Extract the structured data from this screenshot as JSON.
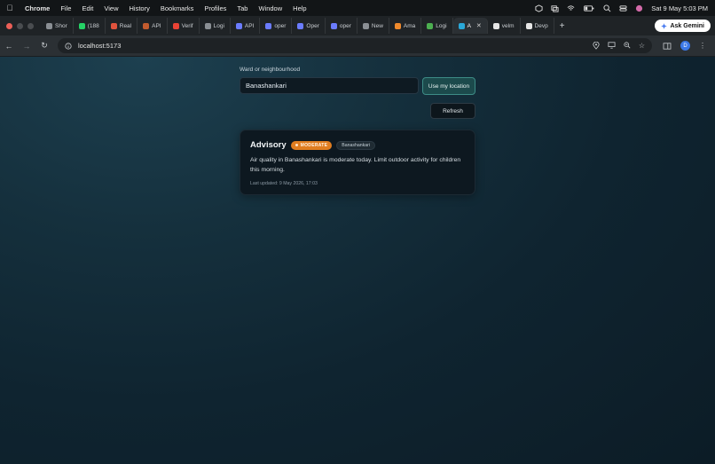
{
  "menubar": {
    "app": "Chrome",
    "items": [
      "File",
      "Edit",
      "View",
      "History",
      "Bookmarks",
      "Profiles",
      "Tab",
      "Window",
      "Help"
    ],
    "datetime": "Sat 9 May  5:03 PM"
  },
  "tabs": [
    {
      "label": "Shor",
      "color": "#8a8f94"
    },
    {
      "label": "(188",
      "color": "#25d366"
    },
    {
      "label": "Real",
      "color": "#e0533d"
    },
    {
      "label": "API",
      "color": "#c25b2e"
    },
    {
      "label": "Verif",
      "color": "#ea4335"
    },
    {
      "label": "Logi",
      "color": "#8a8f94"
    },
    {
      "label": "API",
      "color": "#6b7cff"
    },
    {
      "label": "oper",
      "color": "#6b7cff"
    },
    {
      "label": "Oper",
      "color": "#6b7cff"
    },
    {
      "label": "oper",
      "color": "#6b7cff"
    },
    {
      "label": "New",
      "color": "#8a8f94"
    },
    {
      "label": "Ama",
      "color": "#f08a2c"
    },
    {
      "label": "Logi",
      "color": "#4caf50"
    },
    {
      "label": "A",
      "color": "#2aa8d8",
      "active": true
    },
    {
      "label": "velm",
      "color": "#e6e6e6"
    },
    {
      "label": "Devp",
      "color": "#e6e6e6"
    }
  ],
  "gemini_label": "Ask Gemini",
  "address": {
    "url": "localhost:5173"
  },
  "profile_initial": "D",
  "form": {
    "label": "Ward or neighbourhood",
    "value": "Banashankari",
    "use_location": "Use my location",
    "refresh": "Refresh"
  },
  "advisory": {
    "title": "Advisory",
    "level": "MODERATE",
    "level_color": "#e07d20",
    "ward": "Banashankari",
    "message": "Air quality in Banashankari is moderate today. Limit outdoor activity for children this morning.",
    "updated": "Last updated: 9 May 2026, 17:03"
  }
}
